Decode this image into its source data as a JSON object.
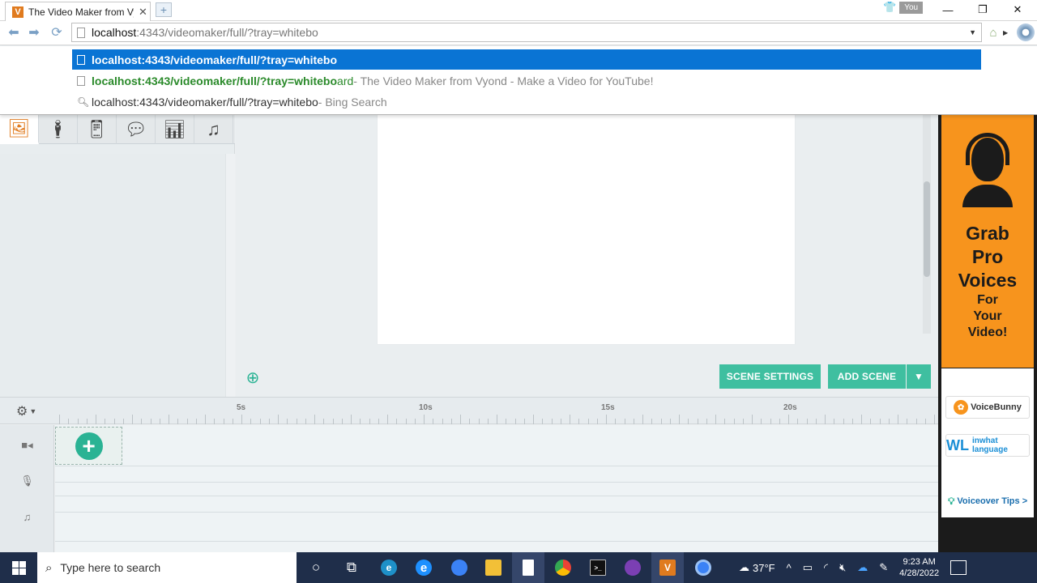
{
  "browser": {
    "tab_title": "The Video Maker from Vy",
    "tab_favicon": "V",
    "tab_close": "✕",
    "new_tab": "+",
    "profile_label": "You",
    "window": {
      "minimize": "—",
      "restore": "❐",
      "close": "✕"
    },
    "address": {
      "host": "localhost",
      "rest": ":4343/videomaker/full/?tray=whitebo"
    }
  },
  "suggestions": [
    {
      "bold": "localhost:4343/videomaker/full/?tray=whitebo"
    },
    {
      "match": "localhost:4343/videomaker/full/?tray=whitebo",
      "rest": "ard",
      "title": " - The Video Maker from Vyond - Make a Video for YouTube!"
    },
    {
      "text": "localhost:4343/videomaker/full/?tray=whitebo",
      "engine": " - Bing Search"
    }
  ],
  "stage": {
    "scene_settings": "SCENE SETTINGS",
    "add_scene": "ADD SCENE"
  },
  "timeline": {
    "ticks": [
      "5s",
      "10s",
      "15s",
      "20s"
    ],
    "add_symbol": "+"
  },
  "ad": {
    "line1": "Grab",
    "line2": "Pro",
    "line3": "Voices",
    "line4": "For",
    "line5": "Your",
    "line6": "Video!",
    "logo1": "VoiceBunny",
    "logo2_mark": "WL",
    "logo2": "inwhat language",
    "tips": "Voiceover Tips >"
  },
  "taskbar": {
    "search_placeholder": "Type here to search",
    "weather": "37°F",
    "time": "9:23 AM",
    "date": "4/28/2022",
    "vyond_letter": "V"
  },
  "colors": {
    "accent_teal": "#3fbfa0",
    "ad_orange": "#f7941d",
    "highlight_blue": "#0a74d4"
  }
}
